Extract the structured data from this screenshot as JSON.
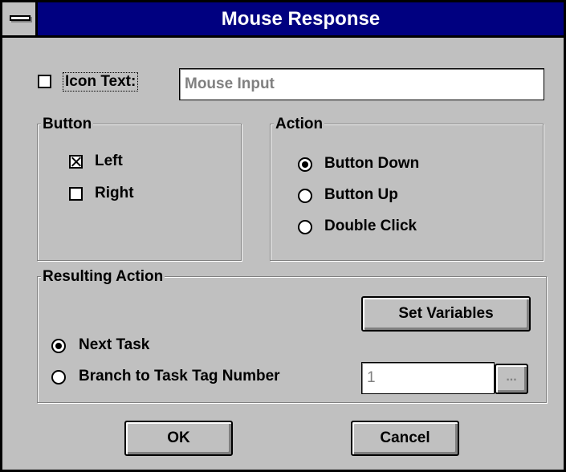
{
  "window": {
    "title": "Mouse Response"
  },
  "icon_text": {
    "label": "Icon Text:",
    "checked": false,
    "value": "Mouse Input"
  },
  "button_group": {
    "label": "Button",
    "items": [
      {
        "label": "Left",
        "checked": true
      },
      {
        "label": "Right",
        "checked": false
      }
    ]
  },
  "action_group": {
    "label": "Action",
    "items": [
      {
        "label": "Button Down",
        "selected": true
      },
      {
        "label": "Button Up",
        "selected": false
      },
      {
        "label": "Double Click",
        "selected": false
      }
    ]
  },
  "resulting_action": {
    "label": "Resulting Action",
    "set_variables_label": "Set Variables",
    "next_task_label": "Next Task",
    "branch_label": "Branch to Task Tag Number",
    "tag_number_value": "1",
    "browse_label": "..."
  },
  "footer": {
    "ok_label": "OK",
    "cancel_label": "Cancel"
  }
}
